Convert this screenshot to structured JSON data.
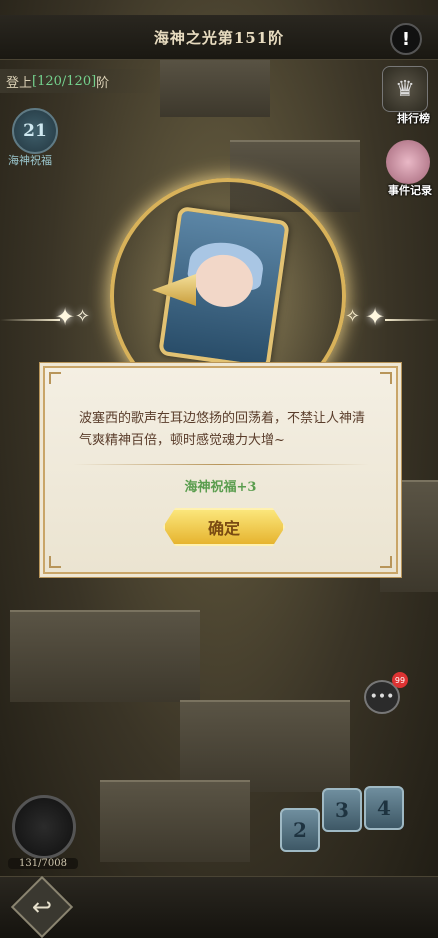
{
  "header": {
    "title": "海神之光第151阶",
    "alert_icon": "exclamation-icon"
  },
  "progress": {
    "prefix": "登上",
    "value": "[120/120]",
    "suffix": "阶"
  },
  "blessing": {
    "count": "21",
    "label": "海神祝福"
  },
  "side_menu": {
    "rank_label": "排行榜",
    "event_label": "事件记录"
  },
  "chat": {
    "badge": "99"
  },
  "orb": {
    "counter": "131/7008"
  },
  "tiles": [
    "2",
    "3",
    "4"
  ],
  "dialog": {
    "message": "波塞西的歌声在耳边悠扬的回荡着，不禁让人神清气爽精神百倍，顿时感觉魂力大增~",
    "reward": "海神祝福+3",
    "confirm_label": "确定"
  },
  "colors": {
    "accent_gold": "#e6b42f",
    "reward_green": "#5a9d4e",
    "progress_green": "#74d28e"
  }
}
